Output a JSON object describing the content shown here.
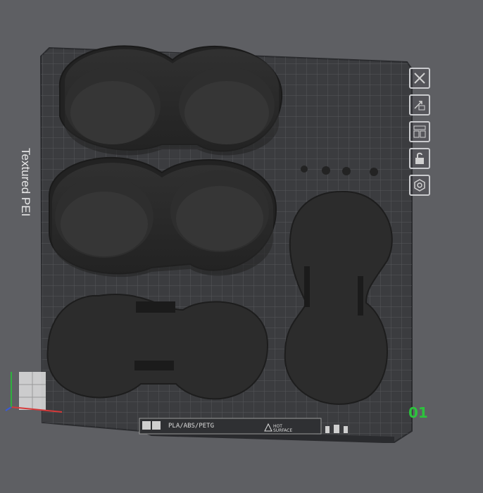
{
  "plate": {
    "side_text": "Textured PEI",
    "label": "PLA/ABS/PETG",
    "warning_line1": "HOT",
    "warning_line2": "SURFACE",
    "number": "01"
  },
  "toolbar": {
    "items": [
      {
        "name": "close",
        "icon": "close-icon"
      },
      {
        "name": "auto-orient",
        "icon": "orient-icon"
      },
      {
        "name": "arrange",
        "icon": "arrange-icon"
      },
      {
        "name": "lock",
        "icon": "lock-icon"
      },
      {
        "name": "settings",
        "icon": "gear-icon"
      }
    ]
  },
  "colors": {
    "background": "#5e5f63",
    "plate": "#3b3c3f",
    "grid": "#55575b",
    "model": "#2b2b2b",
    "accent_green": "#2cc33c",
    "axis_red": "#d63a3a",
    "axis_blue": "#3a5bd6",
    "axis_green": "#2fb03f"
  }
}
